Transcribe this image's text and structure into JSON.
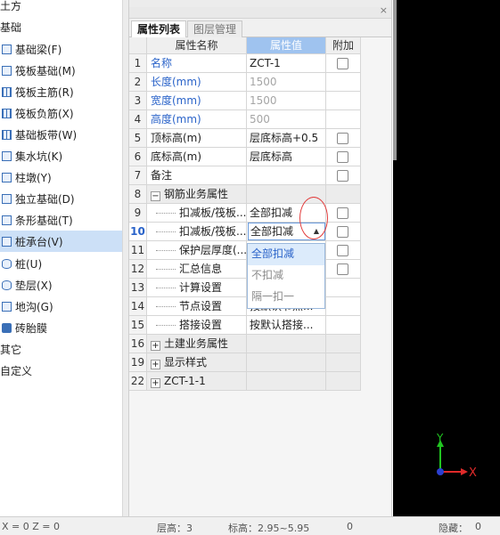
{
  "tree": {
    "items": [
      {
        "label": "土方",
        "icon": "none"
      },
      {
        "label": "基础",
        "icon": "none"
      },
      {
        "label": "基础梁(F)",
        "icon": "beam-icon"
      },
      {
        "label": "筏板基础(M)",
        "icon": "raft-icon"
      },
      {
        "label": "筏板主筋(R)",
        "icon": "rebar-icon"
      },
      {
        "label": "筏板负筋(X)",
        "icon": "rebar-icon"
      },
      {
        "label": "基础板带(W)",
        "icon": "strip-icon"
      },
      {
        "label": "集水坑(K)",
        "icon": "pit-icon"
      },
      {
        "label": "柱墩(Y)",
        "icon": "pier-icon"
      },
      {
        "label": "独立基础(D)",
        "icon": "footing-icon"
      },
      {
        "label": "条形基础(T)",
        "icon": "strip-footing-icon"
      },
      {
        "label": "桩承台(V)",
        "icon": "pile-cap-icon",
        "selected": true
      },
      {
        "label": "桩(U)",
        "icon": "pile-icon"
      },
      {
        "label": "垫层(X)",
        "icon": "cushion-icon"
      },
      {
        "label": "地沟(G)",
        "icon": "trench-icon"
      },
      {
        "label": "砖胎膜",
        "icon": "brick-icon"
      },
      {
        "label": "其它",
        "icon": "none"
      },
      {
        "label": "自定义",
        "icon": "none"
      }
    ]
  },
  "panel": {
    "close": "×",
    "tabs": [
      "属性列表",
      "图层管理"
    ],
    "headers": {
      "name": "属性名称",
      "value": "属性值",
      "extra": "附加"
    },
    "rows": [
      {
        "num": "1",
        "name": "名称",
        "value": "ZCT-1",
        "check": true
      },
      {
        "num": "2",
        "name": "长度(mm)",
        "value": "1500",
        "check": false
      },
      {
        "num": "3",
        "name": "宽度(mm)",
        "value": "1500",
        "check": false
      },
      {
        "num": "4",
        "name": "高度(mm)",
        "value": "500",
        "check": false
      },
      {
        "num": "5",
        "name": "顶标高(m)",
        "value": "层底标高+0.5",
        "check": true
      },
      {
        "num": "6",
        "name": "底标高(m)",
        "value": "层底标高",
        "check": true
      },
      {
        "num": "7",
        "name": "备注",
        "value": "",
        "check": true
      },
      {
        "num": "8",
        "name": "钢筋业务属性",
        "value": "",
        "check": false
      },
      {
        "num": "9",
        "name": "扣减板/筏板...",
        "value": "全部扣减",
        "check": true
      },
      {
        "num": "10",
        "name": "扣减板/筏板...",
        "value": "全部扣减",
        "check": true
      },
      {
        "num": "11",
        "name": "保护层厚度(...",
        "value": "",
        "check": true
      },
      {
        "num": "12",
        "name": "汇总信息",
        "value": "",
        "check": true
      },
      {
        "num": "13",
        "name": "计算设置",
        "value": "",
        "check": false
      },
      {
        "num": "14",
        "name": "节点设置",
        "value": "按默认节点...",
        "check": false
      },
      {
        "num": "15",
        "name": "搭接设置",
        "value": "按默认搭接...",
        "check": false
      },
      {
        "num": "16",
        "name": "土建业务属性",
        "value": "",
        "check": false
      },
      {
        "num": "19",
        "name": "显示样式",
        "value": "",
        "check": false
      },
      {
        "num": "22",
        "name": "ZCT-1-1",
        "value": "",
        "check": false
      }
    ],
    "dropdown": {
      "options": [
        "全部扣减",
        "不扣减",
        "隔一扣一"
      ],
      "selected": "全部扣减"
    }
  },
  "viewport": {
    "axis_y": "Y",
    "axis_x": "X"
  },
  "status": {
    "coords": "X = 0 Z = 0",
    "floor_height": "层高：3",
    "elevation": "标高：2.95~5.95",
    "zero": "0",
    "hidden": "隐藏：",
    "hidden_count": "0"
  }
}
